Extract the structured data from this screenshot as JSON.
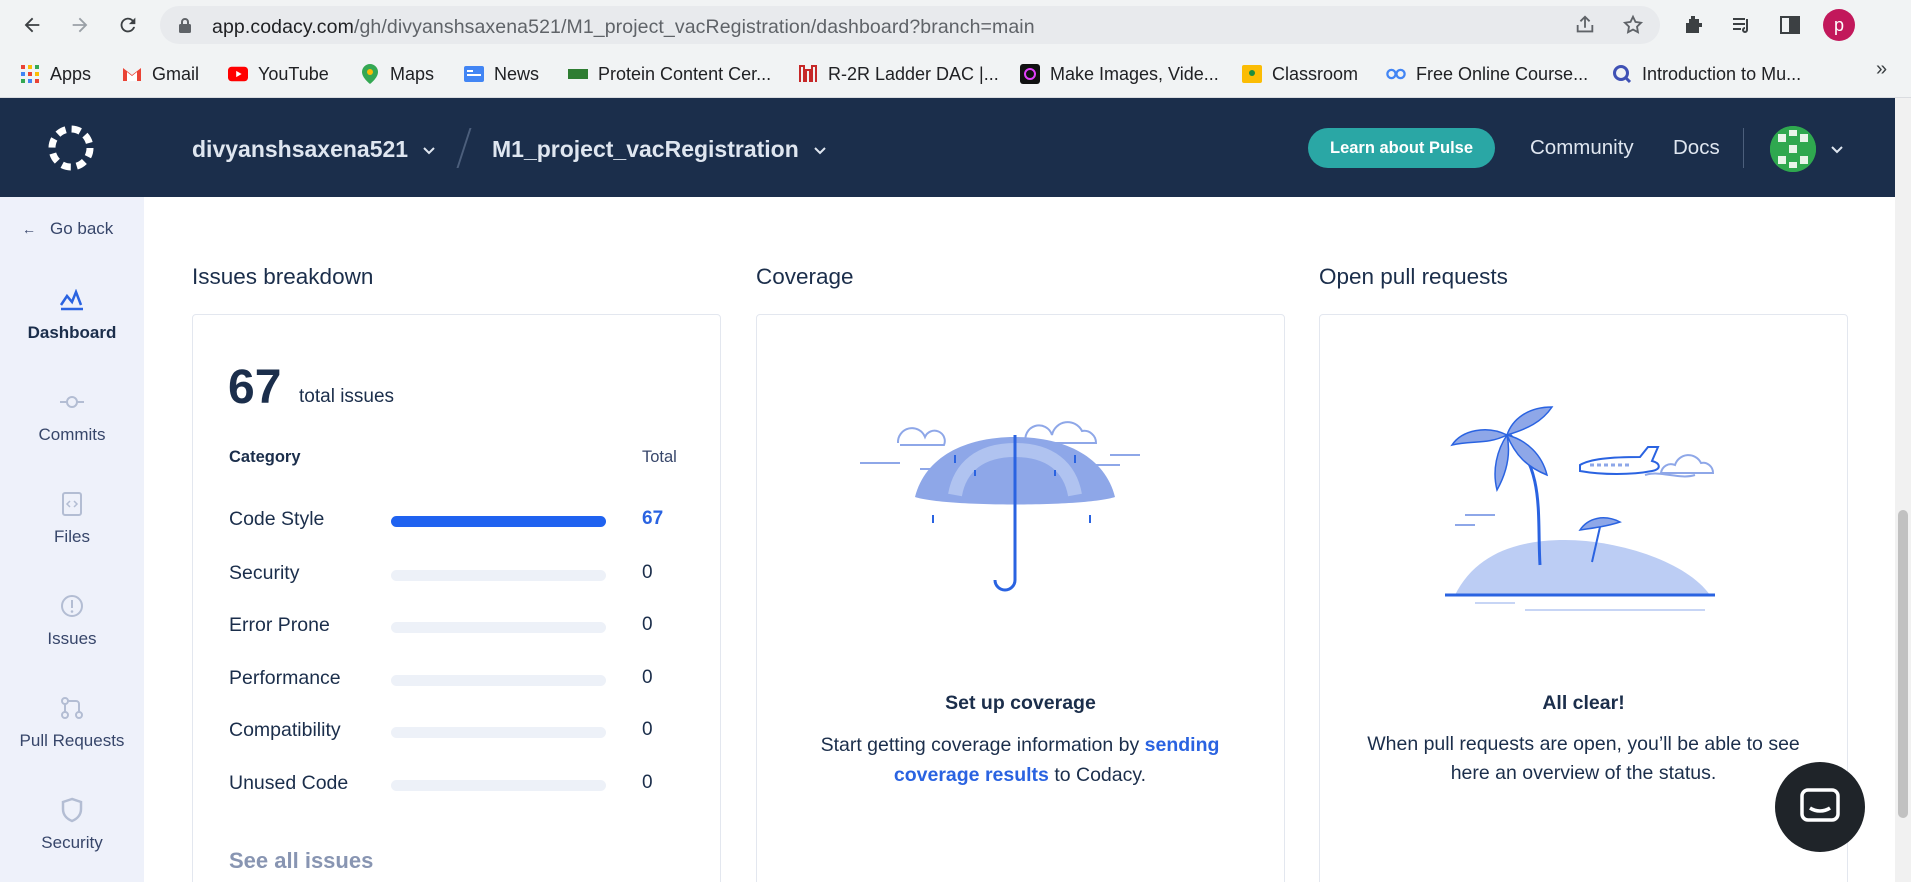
{
  "browser": {
    "url_host": "app.codacy.com",
    "url_path": "/gh/divyanshsaxena521/M1_project_vacRegistration/dashboard?branch=main",
    "profile_initial": "p"
  },
  "bookmarks": [
    {
      "label": "Apps",
      "icon": "apps-grid-icon"
    },
    {
      "label": "Gmail",
      "icon": "gmail-icon"
    },
    {
      "label": "YouTube",
      "icon": "youtube-icon"
    },
    {
      "label": "Maps",
      "icon": "maps-icon"
    },
    {
      "label": "News",
      "icon": "news-icon"
    },
    {
      "label": "Protein Content Cer...",
      "icon": "site-icon"
    },
    {
      "label": "R-2R Ladder DAC |...",
      "icon": "site-icon"
    },
    {
      "label": "Make Images, Vide...",
      "icon": "site-icon"
    },
    {
      "label": "Classroom",
      "icon": "classroom-icon"
    },
    {
      "label": "Free Online Course...",
      "icon": "site-icon"
    },
    {
      "label": "Introduction to Mu...",
      "icon": "site-icon"
    }
  ],
  "header": {
    "org": "divyanshsaxena521",
    "repo": "M1_project_vacRegistration",
    "pulse_button": "Learn about Pulse",
    "community": "Community",
    "docs": "Docs"
  },
  "sidebar": {
    "go_back": "Go back",
    "items": [
      {
        "label": "Dashboard",
        "icon": "dashboard-icon",
        "active": true
      },
      {
        "label": "Commits",
        "icon": "commit-icon",
        "active": false
      },
      {
        "label": "Files",
        "icon": "file-icon",
        "active": false
      },
      {
        "label": "Issues",
        "icon": "issue-icon",
        "active": false
      },
      {
        "label": "Pull Requests",
        "icon": "pull-request-icon",
        "active": false
      },
      {
        "label": "Security",
        "icon": "shield-icon",
        "active": false
      }
    ]
  },
  "issues": {
    "title": "Issues breakdown",
    "total": "67",
    "total_label": "total issues",
    "col_category": "Category",
    "col_total": "Total",
    "rows": [
      {
        "label": "Code Style",
        "value": "67",
        "fraction": 1.0
      },
      {
        "label": "Security",
        "value": "0",
        "fraction": 0
      },
      {
        "label": "Error Prone",
        "value": "0",
        "fraction": 0
      },
      {
        "label": "Performance",
        "value": "0",
        "fraction": 0
      },
      {
        "label": "Compatibility",
        "value": "0",
        "fraction": 0
      },
      {
        "label": "Unused Code",
        "value": "0",
        "fraction": 0
      }
    ],
    "see_all": "See all issues"
  },
  "coverage": {
    "title": "Coverage",
    "heading": "Set up coverage",
    "text_before": "Start getting coverage information by ",
    "link": "sending coverage results",
    "text_after": " to Codacy."
  },
  "pull_requests": {
    "title": "Open pull requests",
    "heading": "All clear!",
    "text": "When pull requests are open, you’ll be able to see here an overview of the status."
  },
  "colors": {
    "header_bg": "#1b2e4b",
    "accent_blue": "#1f62f0",
    "pulse_teal": "#2aa7a5",
    "sidebar_bg": "#eef1fa"
  }
}
